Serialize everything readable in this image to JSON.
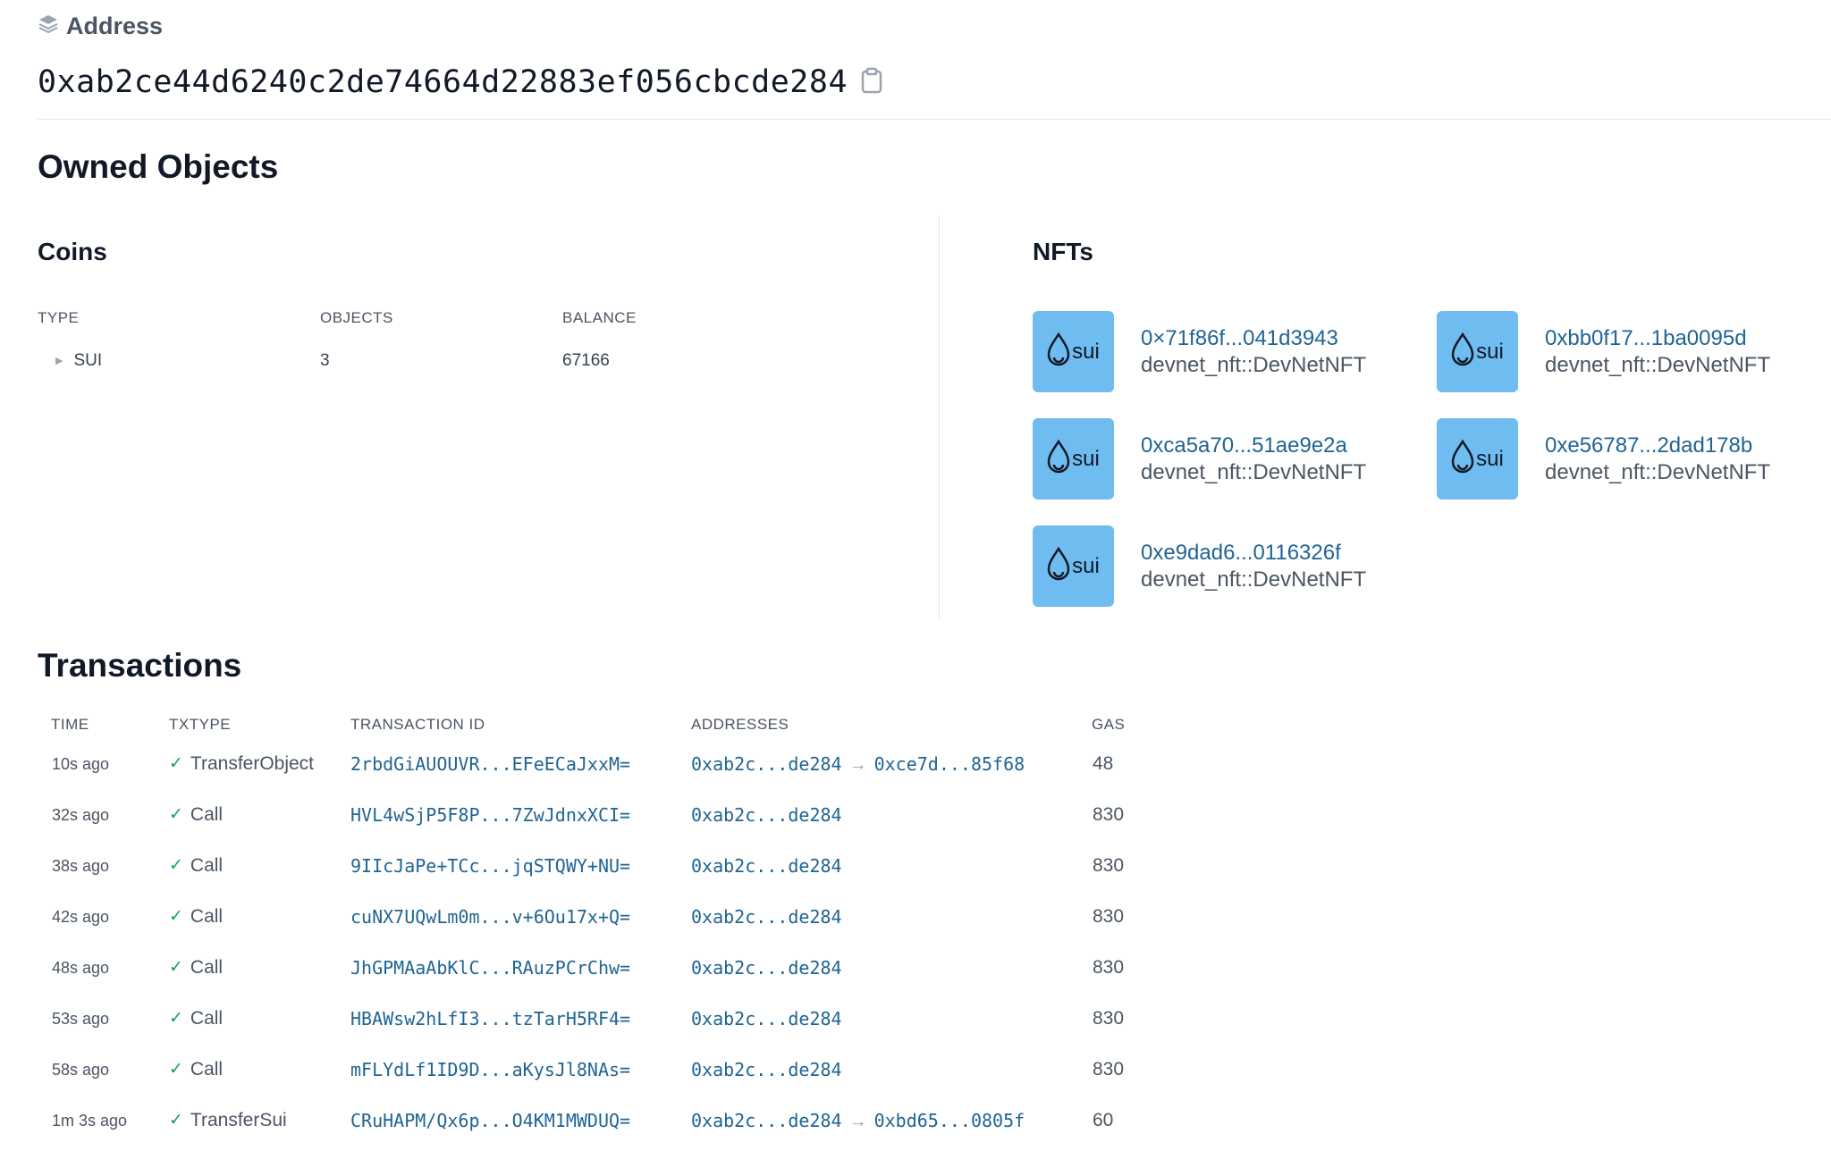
{
  "header": {
    "label": "Address",
    "address": "0xab2ce44d6240c2de74664d22883ef056cbcde284"
  },
  "owned": {
    "title": "Owned Objects",
    "coins": {
      "title": "Coins",
      "columns": [
        "TYPE",
        "OBJECTS",
        "BALANCE"
      ],
      "rows": [
        {
          "type": "SUI",
          "objects": "3",
          "balance": "67166"
        }
      ]
    },
    "nfts": {
      "title": "NFTs",
      "thumb_label": "sui",
      "items": [
        {
          "id": "0×71f86f...041d3943",
          "type": "devnet_nft::DevNetNFT"
        },
        {
          "id": "0xbb0f17...1ba0095d",
          "type": "devnet_nft::DevNetNFT"
        },
        {
          "id": "0xca5a70...51ae9e2a",
          "type": "devnet_nft::DevNetNFT"
        },
        {
          "id": "0xe56787...2dad178b",
          "type": "devnet_nft::DevNetNFT"
        },
        {
          "id": "0xe9dad6...0116326f",
          "type": "devnet_nft::DevNetNFT"
        }
      ]
    }
  },
  "transactions": {
    "title": "Transactions",
    "columns": [
      "TIME",
      "TXTYPE",
      "TRANSACTION ID",
      "ADDRESSES",
      "GAS"
    ],
    "rows": [
      {
        "time": "10s ago",
        "txtype": "TransferObject",
        "id": "2rbdGiAUOUVR...EFeECaJxxM=",
        "from": "0xab2c...de284",
        "to": "0xce7d...85f68",
        "gas": "48"
      },
      {
        "time": "32s ago",
        "txtype": "Call",
        "id": "HVL4wSjP5F8P...7ZwJdnxXCI=",
        "from": "0xab2c...de284",
        "to": "",
        "gas": "830"
      },
      {
        "time": "38s ago",
        "txtype": "Call",
        "id": "9IIcJaPe+TCc...jqSTQWY+NU=",
        "from": "0xab2c...de284",
        "to": "",
        "gas": "830"
      },
      {
        "time": "42s ago",
        "txtype": "Call",
        "id": "cuNX7UQwLm0m...v+6Ou17x+Q=",
        "from": "0xab2c...de284",
        "to": "",
        "gas": "830"
      },
      {
        "time": "48s ago",
        "txtype": "Call",
        "id": "JhGPMAaAbKlC...RAuzPCrChw=",
        "from": "0xab2c...de284",
        "to": "",
        "gas": "830"
      },
      {
        "time": "53s ago",
        "txtype": "Call",
        "id": "HBAWsw2hLfI3...tzTarH5RF4=",
        "from": "0xab2c...de284",
        "to": "",
        "gas": "830"
      },
      {
        "time": "58s ago",
        "txtype": "Call",
        "id": "mFLYdLf1ID9D...aKysJl8NAs=",
        "from": "0xab2c...de284",
        "to": "",
        "gas": "830"
      },
      {
        "time": "1m 3s ago",
        "txtype": "TransferSui",
        "id": "CRuHAPM/Qx6p...O4KM1MWDUQ=",
        "from": "0xab2c...de284",
        "to": "0xbd65...0805f",
        "gas": "60"
      }
    ]
  }
}
